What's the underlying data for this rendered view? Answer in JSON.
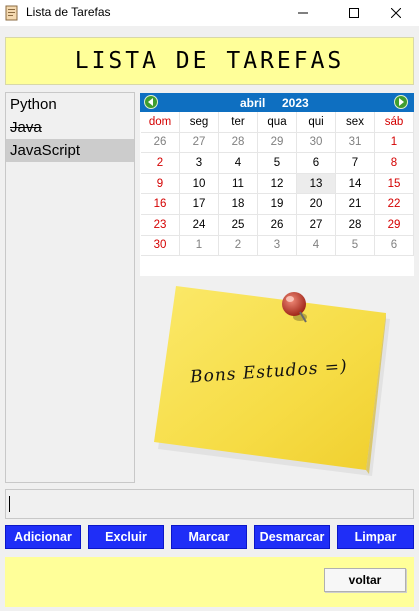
{
  "window": {
    "title": "Lista de Tarefas"
  },
  "header": {
    "title": "LISTA DE TAREFAS"
  },
  "tasks": [
    {
      "label": "Python",
      "done": false,
      "selected": false
    },
    {
      "label": "Java",
      "done": true,
      "selected": false
    },
    {
      "label": "JavaScript",
      "done": false,
      "selected": true
    }
  ],
  "calendar": {
    "month": "abril",
    "year": "2023",
    "weekdays": [
      "dom",
      "seg",
      "ter",
      "qua",
      "qui",
      "sex",
      "sáb"
    ],
    "weeks": [
      [
        "26",
        "27",
        "28",
        "29",
        "30",
        "31",
        "1"
      ],
      [
        "2",
        "3",
        "4",
        "5",
        "6",
        "7",
        "8"
      ],
      [
        "9",
        "10",
        "11",
        "12",
        "13",
        "14",
        "15"
      ],
      [
        "16",
        "17",
        "18",
        "19",
        "20",
        "21",
        "22"
      ],
      [
        "23",
        "24",
        "25",
        "26",
        "27",
        "28",
        "29"
      ],
      [
        "30",
        "1",
        "2",
        "3",
        "4",
        "5",
        "6"
      ]
    ],
    "today": "13"
  },
  "note": {
    "text": "Bons Estudos =)"
  },
  "entry": {
    "value": "",
    "placeholder": ""
  },
  "buttons": {
    "add": "Adicionar",
    "delete": "Excluir",
    "mark": "Marcar",
    "unmark": "Desmarcar",
    "clear": "Limpar",
    "back": "voltar"
  },
  "colors": {
    "banner": "#ffff99",
    "button": "#1f2ef7",
    "calendar_header": "#0e6fc1",
    "weekend": "#d40000",
    "note": "#f7e24a"
  }
}
